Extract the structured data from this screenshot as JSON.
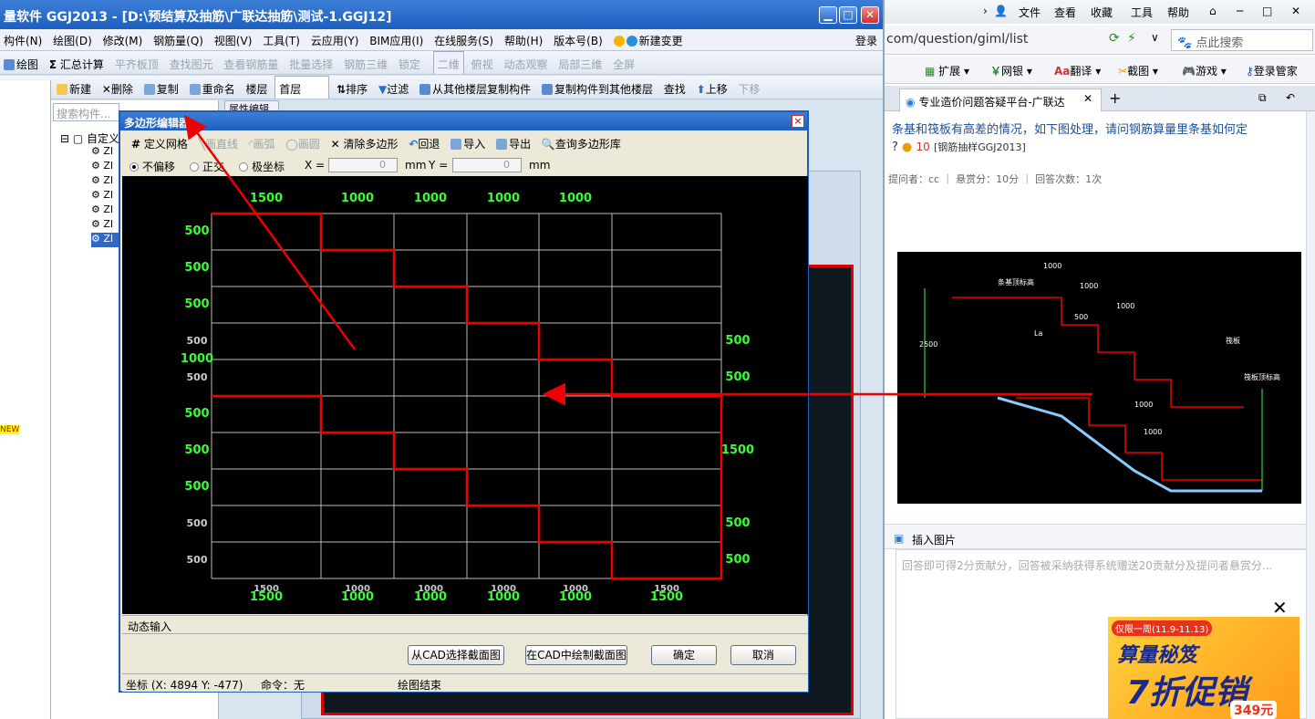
{
  "app": {
    "title": "量软件 GGJ2013 - [D:\\预结算及抽筋\\广联达抽筋\\测试-1.GGJ12]",
    "menu": [
      "构件(N)",
      "绘图(D)",
      "修改(M)",
      "钢筋量(Q)",
      "视图(V)",
      "工具(T)",
      "云应用(Y)",
      "BIM应用(I)",
      "在线服务(S)",
      "帮助(H)",
      "版本号(B)",
      "新建变更",
      "登录"
    ],
    "toolbar1": [
      "绘图",
      "汇总计算",
      "平齐板顶",
      "查找图元",
      "查看钢筋量",
      "批量选择",
      "钢筋三维",
      "锁定",
      "二维",
      "俯视",
      "动态观察",
      "局部三维",
      "全屏"
    ],
    "toolbar2": [
      "新建",
      "删除",
      "复制",
      "重命名",
      "楼层",
      "首层",
      "排序",
      "过滤",
      "从其他楼层复制构件",
      "复制构件到其他楼层",
      "查找",
      "上移",
      "下移"
    ],
    "search_placeholder": "搜索构件...",
    "tree_root": "自定义",
    "tree_items": [
      "ZI",
      "ZI",
      "ZI",
      "ZI",
      "ZI",
      "ZI",
      "ZI"
    ],
    "new_badge": "NEW",
    "prop_tab": "属性编辑"
  },
  "dialog": {
    "title": "多边形编辑器",
    "close": "×",
    "toolbar": [
      "定义网格",
      "画直线",
      "画弧",
      "画圆",
      "清除多边形",
      "回退",
      "导入",
      "导出",
      "查询多边形库"
    ],
    "offset_options": [
      "不偏移",
      "正交",
      "极坐标"
    ],
    "x_label": "X =",
    "y_label": "Y =",
    "x_value": "0",
    "y_value": "0",
    "unit": "mm",
    "dynamic_input": "动态输入",
    "buttons": [
      "从CAD选择截面图",
      "在CAD中绘制截面图",
      "确定",
      "取消"
    ],
    "status_coord": "坐标 (X: 4894 Y: -477)",
    "status_cmd": "命令：无",
    "status_msg": "绘图结束",
    "grid": {
      "top_labels": [
        "1500",
        "1000",
        "1000",
        "1000",
        "1000"
      ],
      "bottom_labels_small": [
        "1500",
        "1000",
        "1000",
        "1000",
        "1000",
        "1500"
      ],
      "bottom_labels": [
        "1500",
        "1000",
        "1000",
        "1000",
        "1000",
        "1500"
      ],
      "left_labels": [
        "500",
        "500",
        "500",
        "500",
        "1000",
        "500",
        "500",
        "500",
        "500",
        "500",
        "500"
      ],
      "right_labels": [
        "500",
        "500",
        "1500",
        "500",
        "500"
      ]
    }
  },
  "browser": {
    "menu": [
      "文件",
      "查看",
      "收藏",
      "工具",
      "帮助"
    ],
    "address": "com/question/giml/list",
    "search_placeholder": "点此搜索",
    "toolbar": [
      "扩展",
      "网银",
      "翻译",
      "截图",
      "游戏",
      "登录管家"
    ],
    "tab_title": "专业造价问题答疑平台-广联达",
    "question_title": "条基和筏板有高差的情况，如下图处理，请问钢筋算量里条基如何定",
    "question_mark": "?",
    "reward": "10",
    "tag": "[钢筋抽样GGJ2013]",
    "asker": "提问者：cc",
    "bounty": "悬赏分：10分",
    "answers": "回答次数：1次",
    "insert_image": "插入图片",
    "answer_placeholder": "回答即可得2分贡献分，回答被采纳获得系统赠送20贡献分及提问者悬赏分...",
    "ad_line1": "仅限一周(11.9-11.13)",
    "ad_line2": "算量秘笈",
    "ad_line3": "7折促销",
    "ad_price": "349元",
    "cad_labels": [
      "1000",
      "1000",
      "1000",
      "1000",
      "1000",
      "La",
      "500",
      "2500",
      "条基顶标高",
      "筏板",
      "筏板顶标高"
    ]
  }
}
